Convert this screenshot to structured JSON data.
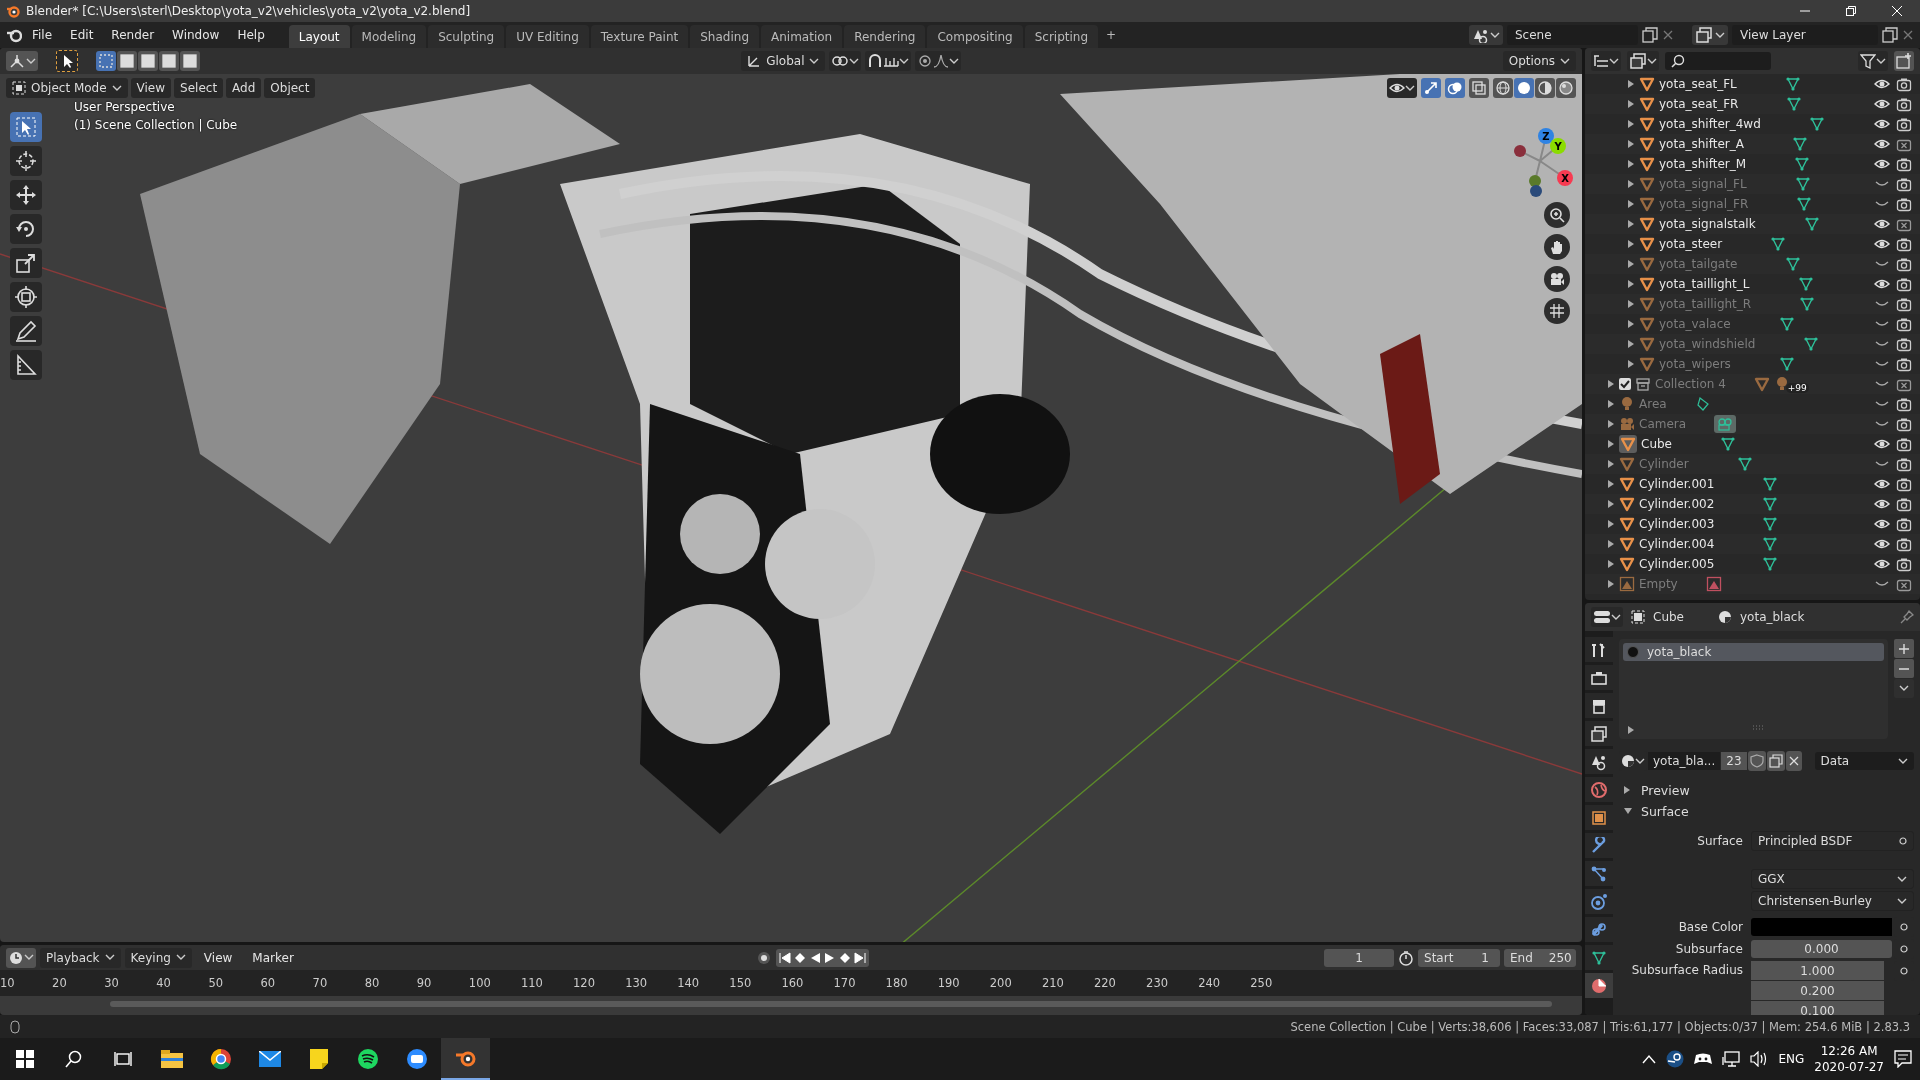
{
  "window": {
    "title": "Blender* [C:\\Users\\sterl\\Desktop\\yota_v2\\vehicles\\yota_v2\\yota_v2.blend]"
  },
  "menu": [
    "File",
    "Edit",
    "Render",
    "Window",
    "Help"
  ],
  "workspaces": [
    {
      "label": "Layout",
      "selected": true
    },
    {
      "label": "Modeling",
      "selected": false
    },
    {
      "label": "Sculpting",
      "selected": false
    },
    {
      "label": "UV Editing",
      "selected": false
    },
    {
      "label": "Texture Paint",
      "selected": false
    },
    {
      "label": "Shading",
      "selected": false
    },
    {
      "label": "Animation",
      "selected": false
    },
    {
      "label": "Rendering",
      "selected": false
    },
    {
      "label": "Compositing",
      "selected": false
    },
    {
      "label": "Scripting",
      "selected": false
    }
  ],
  "add_workspace": "+",
  "scene": {
    "name": "Scene"
  },
  "view_layer": {
    "name": "View Layer"
  },
  "viewport": {
    "orientation": "Global",
    "options": "Options",
    "mode": "Object Mode",
    "menus": [
      "View",
      "Select",
      "Add",
      "Object"
    ],
    "info": [
      "User Perspective",
      "(1) Scene Collection | Cube"
    ],
    "toggles": [
      {
        "kind": "gizmo",
        "on": true
      },
      {
        "kind": "overlay",
        "on": true
      },
      {
        "kind": "xray",
        "on": false
      }
    ],
    "shading": [
      {
        "kind": "wireframe",
        "selected": false
      },
      {
        "kind": "solid",
        "selected": true
      },
      {
        "kind": "material",
        "selected": false
      },
      {
        "kind": "rendered",
        "selected": false
      }
    ],
    "tools": [
      {
        "kind": "select",
        "selected": true
      },
      {
        "kind": "cursor",
        "selected": false
      },
      {
        "kind": "move",
        "selected": false
      },
      {
        "kind": "rotate",
        "selected": false
      },
      {
        "kind": "scale",
        "selected": false
      },
      {
        "kind": "transform",
        "selected": false
      },
      {
        "kind": "annotate",
        "selected": false
      },
      {
        "kind": "measure",
        "selected": false
      }
    ],
    "gizmo_axes": [
      {
        "label": "Z",
        "color": "#2f83e3"
      },
      {
        "label": "Y",
        "color": "#8bdc00"
      },
      {
        "label": "X",
        "color": "#f73a51"
      }
    ]
  },
  "outliner": {
    "clipped_children": [
      {
        "name": "yota_seat_FL",
        "kind": "mesh",
        "visible": true,
        "renderable": true
      },
      {
        "name": "yota_seat_FR",
        "kind": "mesh",
        "visible": true,
        "renderable": true
      },
      {
        "name": "yota_shifter_4wd",
        "kind": "mesh",
        "visible": true,
        "renderable": true
      },
      {
        "name": "yota_shifter_A",
        "kind": "mesh",
        "visible": true,
        "renderable": false
      },
      {
        "name": "yota_shifter_M",
        "kind": "mesh",
        "visible": true,
        "renderable": true
      },
      {
        "name": "yota_signal_FL",
        "kind": "mesh",
        "visible": false,
        "renderable": true
      },
      {
        "name": "yota_signal_FR",
        "kind": "mesh",
        "visible": false,
        "renderable": true
      },
      {
        "name": "yota_signalstalk",
        "kind": "mesh",
        "visible": true,
        "renderable": false
      },
      {
        "name": "yota_steer",
        "kind": "mesh",
        "visible": true,
        "renderable": true
      },
      {
        "name": "yota_tailgate",
        "kind": "mesh",
        "visible": false,
        "renderable": true
      },
      {
        "name": "yota_taillight_L",
        "kind": "mesh",
        "visible": true,
        "renderable": true
      },
      {
        "name": "yota_taillight_R",
        "kind": "mesh",
        "visible": false,
        "renderable": true
      },
      {
        "name": "yota_valace",
        "kind": "mesh",
        "visible": false,
        "renderable": true
      },
      {
        "name": "yota_windshield",
        "kind": "mesh",
        "visible": false,
        "renderable": true
      },
      {
        "name": "yota_wipers",
        "kind": "mesh",
        "visible": false,
        "renderable": true
      }
    ],
    "items": [
      {
        "name": "Collection 4",
        "kind": "collection",
        "checked": true,
        "badge": "+99",
        "visible": false,
        "renderable": false
      },
      {
        "name": "Area",
        "kind": "light",
        "visible": false,
        "renderable": true
      },
      {
        "name": "Camera",
        "kind": "camera",
        "visible": false,
        "renderable": true
      },
      {
        "name": "Cube",
        "kind": "mesh",
        "active": true,
        "visible": true,
        "renderable": true
      },
      {
        "name": "Cylinder",
        "kind": "mesh",
        "visible": false,
        "renderable": true
      },
      {
        "name": "Cylinder.001",
        "kind": "mesh",
        "visible": true,
        "renderable": true
      },
      {
        "name": "Cylinder.002",
        "kind": "mesh",
        "visible": true,
        "renderable": true
      },
      {
        "name": "Cylinder.003",
        "kind": "mesh",
        "visible": true,
        "renderable": true
      },
      {
        "name": "Cylinder.004",
        "kind": "mesh",
        "visible": true,
        "renderable": true
      },
      {
        "name": "Cylinder.005",
        "kind": "mesh",
        "visible": true,
        "renderable": true
      },
      {
        "name": "Empty",
        "kind": "empty",
        "visible": false,
        "renderable": false
      }
    ]
  },
  "properties": {
    "object": "Cube",
    "material": "yota_black",
    "tabs": [
      {
        "kind": "tool",
        "selected": false
      },
      {
        "kind": "render",
        "selected": false
      },
      {
        "kind": "output",
        "selected": false
      },
      {
        "kind": "view_layer",
        "selected": false
      },
      {
        "kind": "scene",
        "selected": false
      },
      {
        "kind": "world",
        "selected": false
      },
      {
        "kind": "object",
        "selected": false
      },
      {
        "kind": "modifiers",
        "selected": false
      },
      {
        "kind": "particles",
        "selected": false
      },
      {
        "kind": "physics",
        "selected": false
      },
      {
        "kind": "constraints",
        "selected": false
      },
      {
        "kind": "data",
        "selected": false
      },
      {
        "kind": "material",
        "selected": true
      }
    ],
    "slots": [
      {
        "name": "yota_black",
        "selected": true
      }
    ],
    "datablock": {
      "name": "yota_bla...",
      "users": "23",
      "link": "Data"
    },
    "panels": [
      {
        "label": "Preview",
        "expanded": false
      },
      {
        "label": "Surface",
        "expanded": true
      }
    ],
    "surface": {
      "label": "Surface",
      "value": "Principled BSDF"
    },
    "dropdowns": [
      "GGX",
      "Christensen-Burley"
    ],
    "base_color": {
      "label": "Base Color",
      "color": "#000000"
    },
    "subsurface": {
      "label": "Subsurface",
      "value": "0.000",
      "level": 0
    },
    "subsurface_radius": {
      "label": "Subsurface Radius",
      "values": [
        "1.000",
        "0.200",
        "0.100"
      ]
    }
  },
  "timeline": {
    "menus": [
      "Playback",
      "Keying",
      "View",
      "Marker"
    ],
    "current_frame": "1",
    "start_label": "Start",
    "start": "1",
    "end_label": "End",
    "end": "250",
    "ruler": [
      "10",
      "20",
      "30",
      "40",
      "50",
      "60",
      "70",
      "80",
      "90",
      "100",
      "110",
      "120",
      "130",
      "140",
      "150",
      "160",
      "170",
      "180",
      "190",
      "200",
      "210",
      "220",
      "230",
      "240",
      "250"
    ]
  },
  "status_bar": "Scene Collection | Cube | Verts:38,606 | Faces:33,087 | Tris:61,177 | Objects:0/37 | Mem: 254.6 MiB | 2.83.3",
  "taskbar": {
    "language": "ENG",
    "time": "12:26 AM",
    "date": "2020-07-27"
  }
}
